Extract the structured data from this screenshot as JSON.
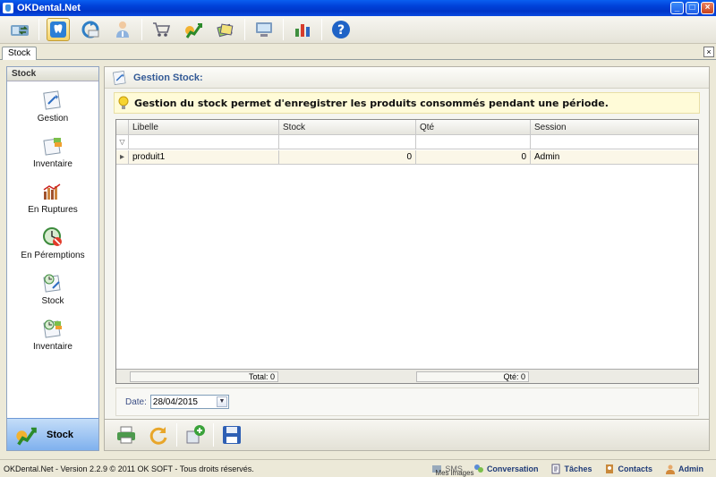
{
  "window": {
    "title": "OKDental.Net",
    "minimize_label": "_",
    "maximize_label": "□",
    "close_label": "×"
  },
  "toolbar": {
    "icons": [
      "stock-transfer-icon",
      "tooth-icon",
      "arrow-circle-icon",
      "doctor-icon",
      "cart-icon",
      "stock-icon",
      "documents-icon",
      "computer-icon",
      "chart-icon",
      "help-icon"
    ],
    "help_label": "?"
  },
  "tabs": [
    {
      "label": "Stock",
      "close_label": "×"
    }
  ],
  "sidebar": {
    "header": "Stock",
    "items": [
      {
        "label": "Gestion",
        "icon": "gestion-icon"
      },
      {
        "label": "Inventaire",
        "icon": "inventory-icon"
      },
      {
        "label": "En Ruptures",
        "icon": "rupture-chart-icon"
      },
      {
        "label": "En Péremptions",
        "icon": "expiry-icon"
      },
      {
        "label": "Stock",
        "icon": "stock-clock-icon"
      },
      {
        "label": "Inventaire",
        "icon": "inventory-clock-icon"
      }
    ],
    "footer": {
      "label": "Stock",
      "icon": "stock-icon"
    }
  },
  "main": {
    "title": "Gestion Stock:",
    "info": "Gestion du stock permet d'enregistrer les produits consommés pendant une période.",
    "grid": {
      "columns": [
        "Libelle",
        "Stock",
        "Qté",
        "Session"
      ],
      "rows": [
        {
          "libelle": "produit1",
          "stock": "0",
          "qte": "0",
          "session": "Admin"
        }
      ],
      "footer": {
        "total": "Total: 0",
        "qte": "Qté: 0"
      }
    },
    "date": {
      "label": "Date:",
      "value": "28/04/2015"
    }
  },
  "bottom_toolbar": {
    "icons": [
      "print-icon",
      "refresh-icon",
      "add-product-icon",
      "save-icon"
    ]
  },
  "statusbar": {
    "version": "OKDental.Net - Version 2.2.9 © 2011 OK SOFT - Tous droits réservés.",
    "sms": "SMS",
    "sms_sub": "Mes images",
    "conversation": "Conversation",
    "taches": "Tâches",
    "contacts": "Contacts",
    "user": "Admin"
  },
  "colors": {
    "titlebar": "#0040d8",
    "accent_blue": "#335a96",
    "info_bg": "#fffbd8",
    "sidebar_active": "#7fb1ee"
  }
}
